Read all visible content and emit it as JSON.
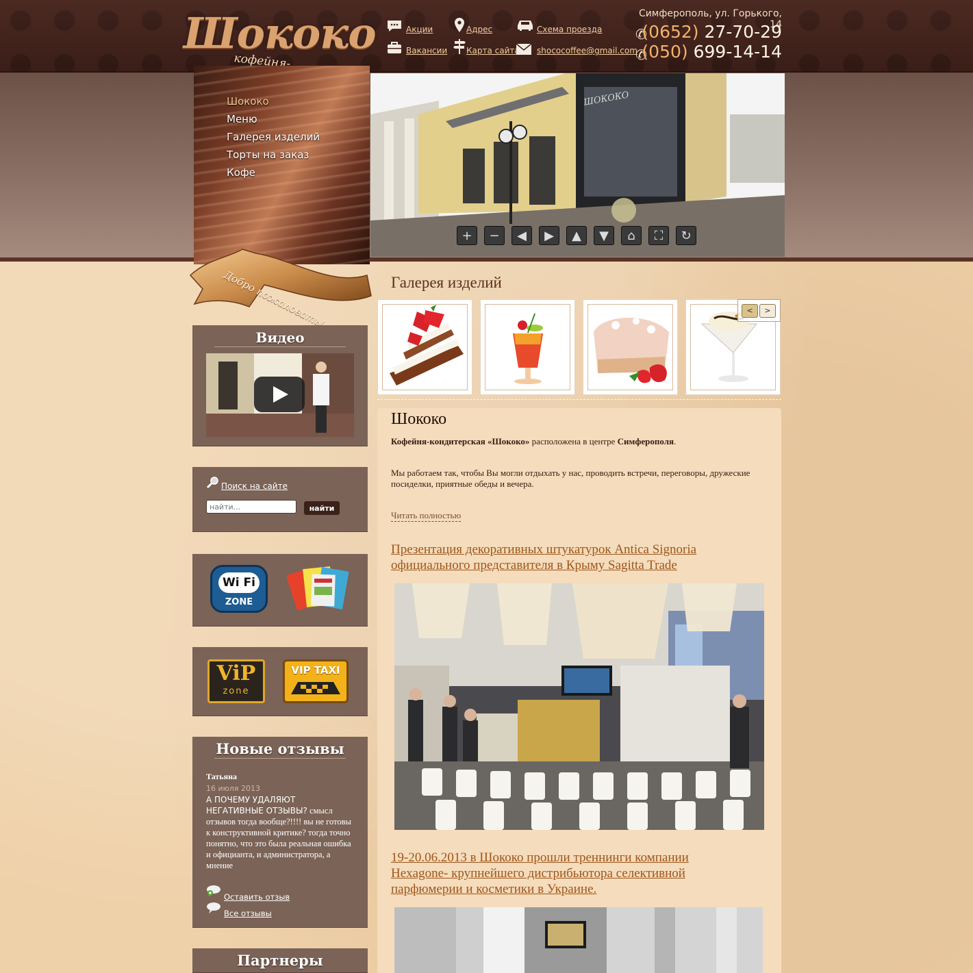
{
  "header": {
    "logo_text": "Шококо",
    "logo_subtitle": "кофейня-кондитерская",
    "links": {
      "promo": "Акции",
      "address": "Адрес",
      "route": "Схема проезда",
      "vacancies": "Вакансии",
      "sitemap": "Карта сайта",
      "email": "shococoffee@gmail.com"
    },
    "address": "Симферополь, ул. Горького,  14",
    "phone1_code": "(0652)",
    "phone1_number": "27-70-29",
    "phone2_code": "(050)",
    "phone2_number": "699-14-14"
  },
  "nav": {
    "items": [
      {
        "label": "Шококо",
        "active": true
      },
      {
        "label": "Меню"
      },
      {
        "label": "Галерея изделий"
      },
      {
        "label": "Торты на заказ"
      },
      {
        "label": "Кофе"
      }
    ]
  },
  "welcome_ribbon": "Добро пожаловать!",
  "panorama": {
    "building_sign": "ШОКОКО",
    "controls": [
      "zoom-in",
      "zoom-out",
      "left",
      "right",
      "up",
      "down",
      "home",
      "fullscreen",
      "rotate"
    ]
  },
  "sidebar": {
    "video_title": "Видео",
    "search_link": "Поиск на сайте",
    "search_placeholder": "найти...",
    "search_button": "найти",
    "wifi_label": "Wi Fi",
    "wifi_zone": "ZONE",
    "vip_zone_top": "ViP",
    "vip_zone_bottom": "zone",
    "vip_taxi": "VIP TAXI",
    "reviews_title": "Новые отзывы",
    "review_author": "Татьяна",
    "review_date": "16 июля 2013",
    "review_text_caps": "А ПОЧЕМУ УДАЛЯЮТ НЕГАТИВНЫЕ ОТЗЫВЫ?",
    "review_text_rest": " смысл отзывов тогда вообще?!!!! вы не готовы к конструктивной критике? тогда точно понятно, что это была реальная ошибка и официанта, и администратора, а мнение",
    "leave_review": "Оставить отзыв",
    "all_reviews": "Все отзывы",
    "partners_title": "Партнеры"
  },
  "gallery": {
    "title": "Галерея изделий",
    "prev": "<",
    "next": ">"
  },
  "about": {
    "title": "Шококо",
    "p1_bold1": "Кофейня-кондитерская «Шококо»",
    "p1_mid": " расположена в центре ",
    "p1_bold2": "Симферополя",
    "p1_end": ".",
    "p2": "Мы работаем так, чтобы Вы могли отдыхать у нас, проводить встречи, переговоры, дружеские посиделки, приятные обеды и вечера.",
    "read_more": "Читать полностью"
  },
  "articles": [
    {
      "title": "Презентация декоративных штукатурок Antica Signoria официального представителя в Крыму Sagitta Trade"
    },
    {
      "title": "19-20.06.2013 в Шококо прошли треннинги компании Hexagone- крупнейшего дистрибьютора селективной парфюмерии и косметики в Украине."
    }
  ],
  "colors": {
    "header_bg": "#3f221b",
    "page_bg": "#efd1a9",
    "sidebar_box": "#7b6357",
    "link": "#a0561b",
    "heading": "#5b2f1e"
  }
}
